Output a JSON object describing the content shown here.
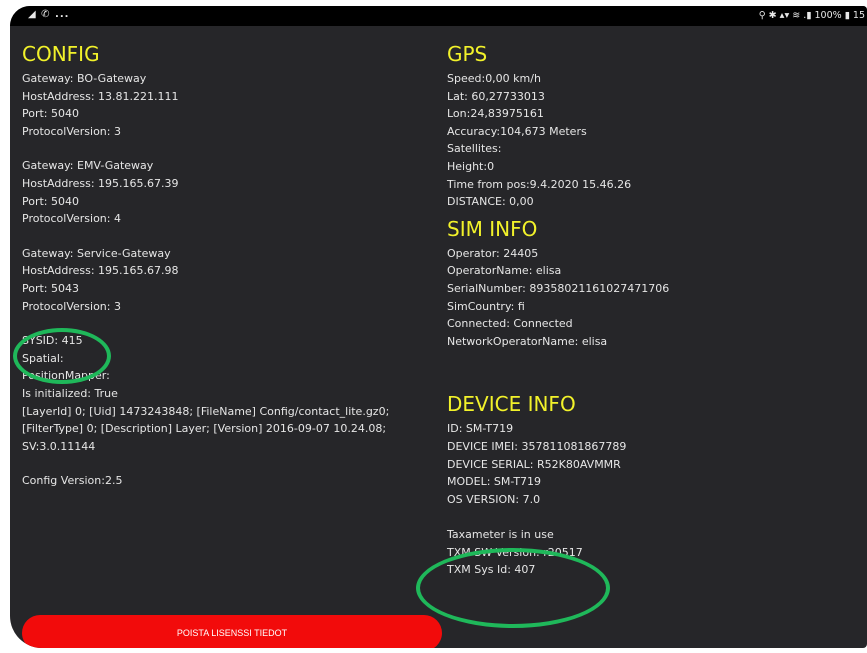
{
  "statusbar": {
    "left": "◢ ✆ ...",
    "right": "⚲ ✱ ▴▾ ≋ .▮ 100% ▮ 15"
  },
  "config": {
    "title": "CONFIG",
    "gateways": [
      {
        "lines": [
          "Gateway: BO-Gateway",
          " HostAddress: 13.81.221.111",
          " Port: 5040",
          " ProtocolVersion: 3"
        ]
      },
      {
        "lines": [
          "Gateway: EMV-Gateway",
          " HostAddress: 195.165.67.39",
          " Port: 5040",
          " ProtocolVersion: 4"
        ]
      },
      {
        "lines": [
          "Gateway: Service-Gateway",
          " HostAddress: 195.165.67.98",
          " Port: 5043",
          " ProtocolVersion: 3"
        ]
      }
    ],
    "sysid": "SYSID: 415",
    "spatial": "Spatial:",
    "position_mapper": "PositionMapper:",
    "initialized": "Is initialized: True",
    "layer_info": "[LayerId] 0; [Uid] 1473243848; [FileName] Config/contact_lite.gz0; [FilterType] 0; [Description] Layer; [Version] 2016-09-07 10.24.08; SV:3.0.11144",
    "config_version": "Config Version:2.5"
  },
  "gps": {
    "title": "GPS",
    "lines": [
      "Speed:0,00 km/h",
      "Lat: 60,27733013",
      "Lon:24,83975161",
      "Accuracy:104,673 Meters",
      "Satellites:",
      "Height:0",
      "Time from pos:9.4.2020 15.46.26",
      "DISTANCE: 0,00"
    ]
  },
  "sim": {
    "title": "SIM INFO",
    "lines": [
      "Operator: 24405",
      "OperatorName: elisa",
      "SerialNumber: 89358021161027471706",
      "SimCountry: fi",
      "Connected: Connected",
      "NetworkOperatorName: elisa"
    ]
  },
  "device": {
    "title": "DEVICE INFO",
    "lines": [
      "ID: SM-T719",
      "DEVICE IMEI: 357811081867789",
      "DEVICE SERIAL: R52K80AVMMR",
      "MODEL: SM-T719",
      "OS VERSION: 7.0"
    ],
    "taxameter": [
      "Taxameter is in use",
      "TXM SW Version: r20517",
      "TXM Sys Id: 407"
    ]
  },
  "button": {
    "label": "POISTA LISENSSI TIEDOT"
  },
  "colors": {
    "heading": "#f2f22a",
    "highlight": "#1fb85a",
    "button": "#f20b0b",
    "background": "#262629"
  }
}
